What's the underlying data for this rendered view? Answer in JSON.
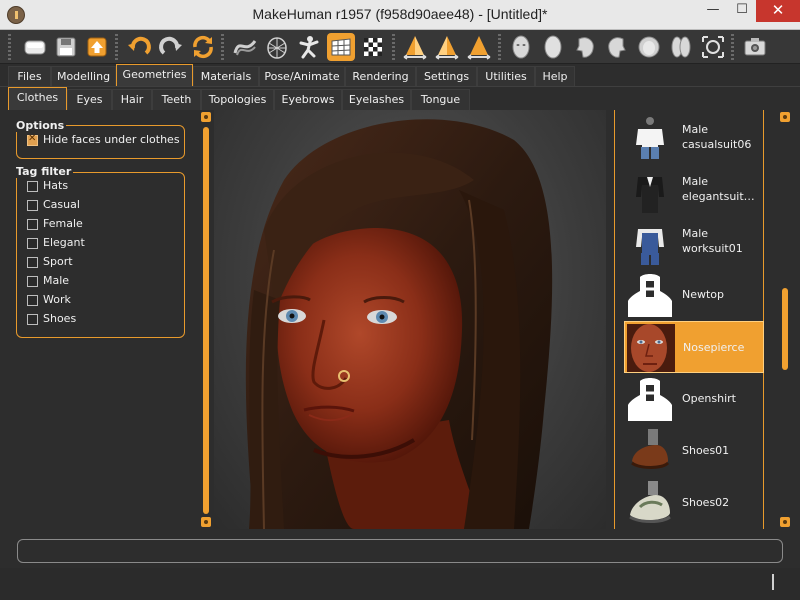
{
  "window": {
    "title": "MakeHuman r1957 (f958d90aee48) - [Untitled]*",
    "minimize": "—",
    "maximize": "☐",
    "close": "✕"
  },
  "toolbar": {
    "buttons": [
      {
        "name": "toggle-view-icon"
      },
      {
        "name": "save-icon"
      },
      {
        "name": "export-icon"
      },
      {
        "name": "undo-icon"
      },
      {
        "name": "redo-icon"
      },
      {
        "name": "reset-icon"
      },
      {
        "name": "smooth-icon"
      },
      {
        "name": "wireframe-icon"
      },
      {
        "name": "pose-icon"
      },
      {
        "name": "grid-icon"
      },
      {
        "name": "checker-background-icon"
      },
      {
        "name": "front-view-icon"
      },
      {
        "name": "side-view-icon"
      },
      {
        "name": "back-view-icon"
      },
      {
        "name": "face-front-icon"
      },
      {
        "name": "face-back-icon"
      },
      {
        "name": "face-left-icon"
      },
      {
        "name": "face-right-icon"
      },
      {
        "name": "face-top-icon"
      },
      {
        "name": "face-bottom-icon"
      },
      {
        "name": "reset-camera-icon"
      },
      {
        "name": "screenshot-icon"
      }
    ]
  },
  "tabs_main": [
    {
      "label": "Files"
    },
    {
      "label": "Modelling"
    },
    {
      "label": "Geometries",
      "active": true
    },
    {
      "label": "Materials"
    },
    {
      "label": "Pose/Animate"
    },
    {
      "label": "Rendering"
    },
    {
      "label": "Settings"
    },
    {
      "label": "Utilities"
    },
    {
      "label": "Help"
    }
  ],
  "tabs_sub": [
    {
      "label": "Clothes",
      "active": true
    },
    {
      "label": "Eyes"
    },
    {
      "label": "Hair"
    },
    {
      "label": "Teeth"
    },
    {
      "label": "Topologies"
    },
    {
      "label": "Eyebrows"
    },
    {
      "label": "Eyelashes"
    },
    {
      "label": "Tongue"
    }
  ],
  "options": {
    "title": "Options",
    "hide_faces": {
      "label": "Hide faces under clothes",
      "checked": true
    }
  },
  "tag_filter": {
    "title": "Tag filter",
    "tags": [
      {
        "label": "Hats",
        "checked": false
      },
      {
        "label": "Casual",
        "checked": false
      },
      {
        "label": "Female",
        "checked": false
      },
      {
        "label": "Elegant",
        "checked": false
      },
      {
        "label": "Sport",
        "checked": false
      },
      {
        "label": "Male",
        "checked": false
      },
      {
        "label": "Work",
        "checked": false
      },
      {
        "label": "Shoes",
        "checked": false
      }
    ]
  },
  "clothes_list": [
    {
      "label": "Male\ncasualsuit06",
      "thumb": "casualsuit"
    },
    {
      "label": "Male\nelegantsuit…",
      "thumb": "elegantsuit"
    },
    {
      "label": "Male\nworksuit01",
      "thumb": "worksuit"
    },
    {
      "label": "Newtop",
      "thumb": "placeholder"
    },
    {
      "label": "Nosepierce",
      "thumb": "face",
      "selected": true
    },
    {
      "label": "Openshirt",
      "thumb": "placeholder"
    },
    {
      "label": "Shoes01",
      "thumb": "shoe-brown"
    },
    {
      "label": "Shoes02",
      "thumb": "shoe-sport"
    }
  ],
  "colors": {
    "accent": "#f0a030",
    "background": "#2d2d2d",
    "text": "#f0f0f0"
  },
  "command_line": {
    "value": ""
  }
}
